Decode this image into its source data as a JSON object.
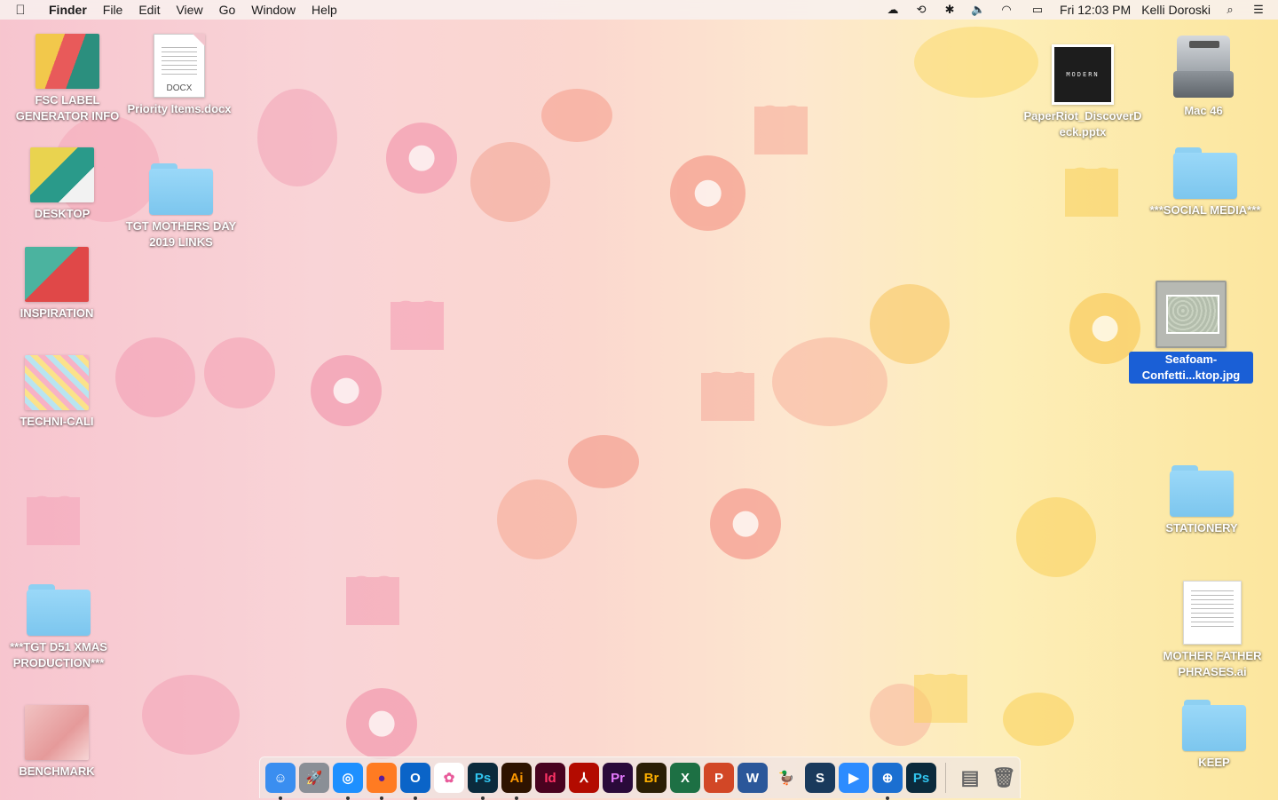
{
  "menubar": {
    "apple_icon": "apple-icon",
    "items": [
      "Finder",
      "File",
      "Edit",
      "View",
      "Go",
      "Window",
      "Help"
    ],
    "status_icons": [
      "creative-cloud-icon",
      "sync-icon",
      "bluetooth-icon",
      "volume-icon",
      "wifi-icon",
      "battery-charging-icon"
    ],
    "clock": "Fri 12:03 PM",
    "user": "Kelli Doroski",
    "spotlight_icon": "search-icon",
    "notification_icon": "list-icon"
  },
  "desktop": {
    "left_column": [
      {
        "label": "FSC LABEL GENERATOR INFO",
        "type": "image"
      },
      {
        "label": "Priority Items.docx",
        "type": "document",
        "ext": "DOCX"
      },
      {
        "label": "DESKTOP",
        "type": "image"
      },
      {
        "label": "TGT MOTHERS DAY 2019 LINKS",
        "type": "folder"
      },
      {
        "label": "INSPIRATION",
        "type": "image"
      },
      {
        "label": "TECHNI-CALI",
        "type": "image"
      },
      {
        "label": "***TGT D51 XMAS PRODUCTION***",
        "type": "folder"
      },
      {
        "label": "BENCHMARK",
        "type": "image"
      }
    ],
    "right_column": [
      {
        "label": "PaperRiot_DiscoverDeck.pptx",
        "type": "pptx",
        "thumb_text": "MODERN"
      },
      {
        "label": "Mac 46",
        "type": "hdd"
      },
      {
        "label": "***SOCIAL MEDIA***",
        "type": "folder"
      },
      {
        "label": "Seafoam-Confetti...ktop.jpg",
        "type": "image",
        "selected": true
      },
      {
        "label": "STATIONERY",
        "type": "folder"
      },
      {
        "label": "MOTHER FATHER PHRASES.ai",
        "type": "document"
      },
      {
        "label": "KEEP",
        "type": "folder"
      }
    ]
  },
  "dock": {
    "apps": [
      {
        "name": "Finder",
        "glyph": "☺",
        "bg": "#3a8ef0",
        "fg": "#fff",
        "running": true
      },
      {
        "name": "Launchpad",
        "glyph": "🚀",
        "bg": "#8a8f96",
        "fg": "#fff",
        "running": false
      },
      {
        "name": "Safari",
        "glyph": "◎",
        "bg": "#1e90ff",
        "fg": "#fff",
        "running": true
      },
      {
        "name": "Firefox",
        "glyph": "●",
        "bg": "#ff7b22",
        "fg": "#5b1d9b",
        "running": true
      },
      {
        "name": "Outlook",
        "glyph": "O",
        "bg": "#0a64c8",
        "fg": "#fff",
        "running": true
      },
      {
        "name": "Photos",
        "glyph": "✿",
        "bg": "#ffffff",
        "fg": "#e85a9a",
        "running": false
      },
      {
        "name": "Photoshop",
        "glyph": "Ps",
        "bg": "#0b2a3c",
        "fg": "#31c5f0",
        "running": true
      },
      {
        "name": "Illustrator",
        "glyph": "Ai",
        "bg": "#2e1300",
        "fg": "#ff9a00",
        "running": true
      },
      {
        "name": "InDesign",
        "glyph": "Id",
        "bg": "#49021f",
        "fg": "#ff3366",
        "running": false
      },
      {
        "name": "Acrobat",
        "glyph": "⅄",
        "bg": "#b30b00",
        "fg": "#fff",
        "running": false
      },
      {
        "name": "Premiere",
        "glyph": "Pr",
        "bg": "#2a0a3a",
        "fg": "#e77bff",
        "running": false
      },
      {
        "name": "Bridge",
        "glyph": "Br",
        "bg": "#2b1e05",
        "fg": "#ffb000",
        "running": false
      },
      {
        "name": "Excel",
        "glyph": "X",
        "bg": "#1d7044",
        "fg": "#fff",
        "running": false
      },
      {
        "name": "PowerPoint",
        "glyph": "P",
        "bg": "#d24726",
        "fg": "#fff",
        "running": false
      },
      {
        "name": "Word",
        "glyph": "W",
        "bg": "#2b579a",
        "fg": "#fff",
        "running": false
      },
      {
        "name": "Cyberduck",
        "glyph": "🦆",
        "bg": "transparent",
        "fg": "#f5c000",
        "running": false
      },
      {
        "name": "Scrivener",
        "glyph": "S",
        "bg": "#1a3a5c",
        "fg": "#fff",
        "running": false
      },
      {
        "name": "Zoom",
        "glyph": "▶",
        "bg": "#2d8cff",
        "fg": "#fff",
        "running": false
      },
      {
        "name": "Network Utility",
        "glyph": "⊕",
        "bg": "#1b6fd1",
        "fg": "#fff",
        "running": true
      },
      {
        "name": "Photoshop 2",
        "glyph": "Ps",
        "bg": "#0b2a3c",
        "fg": "#31c5f0",
        "running": false
      }
    ],
    "trailing": [
      {
        "name": "Downloads",
        "glyph": "▤"
      },
      {
        "name": "Trash",
        "glyph": "🗑"
      }
    ]
  },
  "colors": {
    "selection": "#1a5fd6",
    "folder": "#8ed0f2"
  }
}
